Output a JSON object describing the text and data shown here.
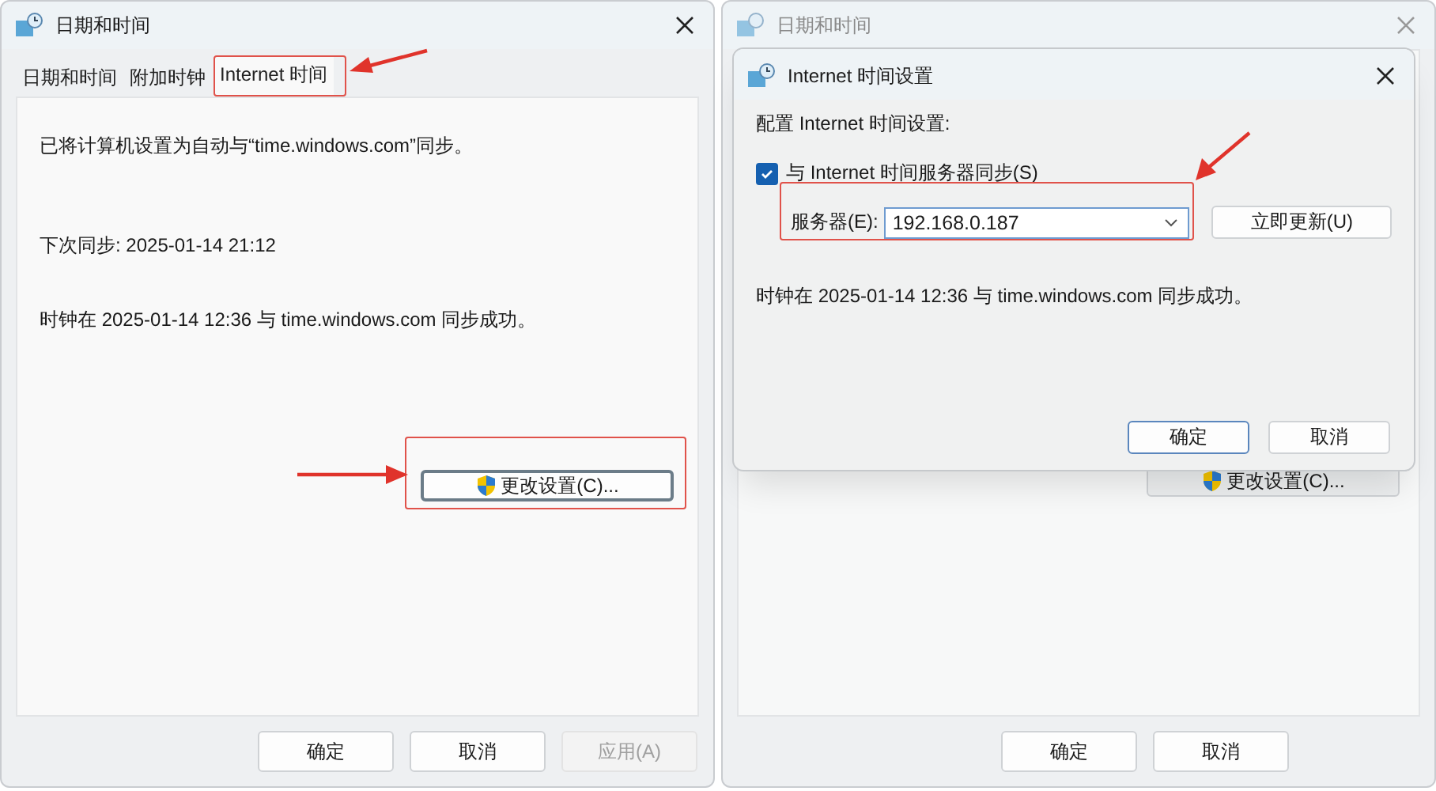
{
  "left_dialog": {
    "title": "日期和时间",
    "tabs": [
      {
        "label": "日期和时间",
        "selected": false
      },
      {
        "label": "附加时钟",
        "selected": false
      },
      {
        "label": "Internet 时间",
        "selected": true
      }
    ],
    "lines": [
      "已将计算机设置为自动与“time.windows.com”同步。",
      "下次同步: 2025-01-14 21:12",
      "时钟在 2025-01-14 12:36 与 time.windows.com 同步成功。"
    ],
    "change_button": "更改设置(C)...",
    "buttons": [
      {
        "label": "确定",
        "disabled": false
      },
      {
        "label": "取消",
        "disabled": false
      },
      {
        "label": "应用(A)",
        "disabled": true
      }
    ]
  },
  "right_dialog": {
    "title": "日期和时间",
    "change_button": "更改设置(C)...",
    "buttons": [
      {
        "label": "确定",
        "disabled": false
      },
      {
        "label": "取消",
        "disabled": false
      }
    ]
  },
  "modal": {
    "title": "Internet 时间设置",
    "heading": "配置 Internet 时间设置:",
    "sync_checkbox": {
      "label": "与 Internet 时间服务器同步(S)",
      "checked": true
    },
    "server": {
      "label": "服务器(E):",
      "value": "192.168.0.187"
    },
    "update_button": "立即更新(U)",
    "status": "时钟在 2025-01-14 12:36 与 time.windows.com 同步成功。",
    "buttons": [
      {
        "label": "确定",
        "default": true
      },
      {
        "label": "取消",
        "default": false
      }
    ]
  }
}
